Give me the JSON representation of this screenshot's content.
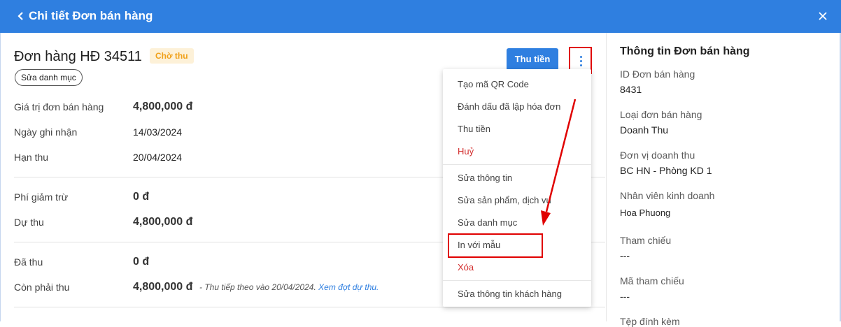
{
  "header": {
    "title": "Chi tiết Đơn bán hàng",
    "back_icon": "chevron-left-icon",
    "close_icon": "close-icon"
  },
  "order": {
    "title": "Đơn hàng HĐ 34511",
    "status": "Chờ thu",
    "edit_category": "Sửa danh mục",
    "fields": [
      {
        "label": "Giá trị đơn bán hàng",
        "value": "4,800,000 đ"
      },
      {
        "label": "Ngày ghi nhận",
        "value": "14/03/2024"
      },
      {
        "label": "Hạn thu",
        "value": "20/04/2024"
      },
      {
        "label": "Phí giảm trừ",
        "value": "0 đ"
      },
      {
        "label": "Dự thu",
        "value": "4,800,000 đ"
      },
      {
        "label": "Đã thu",
        "value": "0 đ"
      },
      {
        "label": "Còn phải thu",
        "value": "4,800,000 đ"
      }
    ],
    "note_text": "- Thu tiếp theo vào 20/04/2024.",
    "note_link": "Xem đợt dự thu."
  },
  "toolbar": {
    "pay_label": "Thu tiền",
    "more_icon": "more-vertical-icon"
  },
  "menu": {
    "items": [
      {
        "label": "Tạo mã QR Code"
      },
      {
        "label": "Đánh dấu đã lập hóa đơn"
      },
      {
        "label": "Thu tiền"
      },
      {
        "label": "Huỷ"
      },
      {
        "label": "Sửa thông tin"
      },
      {
        "label": "Sửa sản phẩm, dịch vụ"
      },
      {
        "label": "Sửa danh mục"
      },
      {
        "label": "In với mẫu"
      },
      {
        "label": "Xóa"
      },
      {
        "label": "Sửa thông tin khách hàng"
      }
    ]
  },
  "sidebar": {
    "title": "Thông tin Đơn bán hàng",
    "fields": [
      {
        "label": "ID Đơn bán hàng",
        "value": "8431"
      },
      {
        "label": "Loại đơn bán hàng",
        "value": "Doanh Thu"
      },
      {
        "label": "Đơn vị doanh thu",
        "value": "BC HN - Phòng KD 1"
      },
      {
        "label": "Nhân viên kinh doanh",
        "value": "Hoa Phuong"
      },
      {
        "label": "Tham chiếu",
        "value": "---"
      },
      {
        "label": "Mã tham chiếu",
        "value": "---"
      },
      {
        "label": "Tệp đính kèm",
        "value": ""
      }
    ]
  },
  "colors": {
    "primary": "#2f7fe0",
    "danger": "#d32f2f",
    "badge_bg": "#fdf1d8",
    "badge_text": "#f0a019",
    "highlight": "#e00000"
  }
}
